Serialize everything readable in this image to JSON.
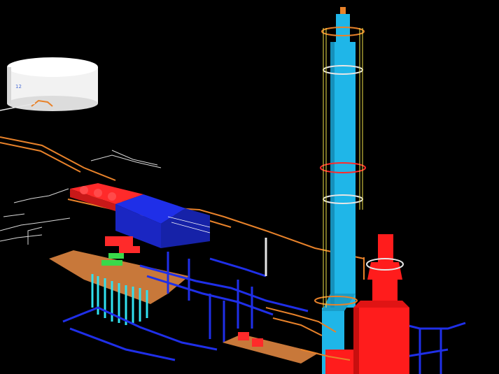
{
  "scene": {
    "background": "#000000",
    "tank_label": "12",
    "colors": {
      "tank": "#f2f2f2",
      "column": "#1fb6e8",
      "stack": "#ff1c1c",
      "pipe_orange": "#e8822a",
      "pipe_blue": "#1f2fe8",
      "pipe_white": "#e6e6e6",
      "ladder_yellow": "#f2e34a",
      "skid_red": "#ff2a2a",
      "cyan_piles": "#31e2f0",
      "green_equipment": "#39d94a",
      "platform_tan": "#c8783a"
    }
  }
}
